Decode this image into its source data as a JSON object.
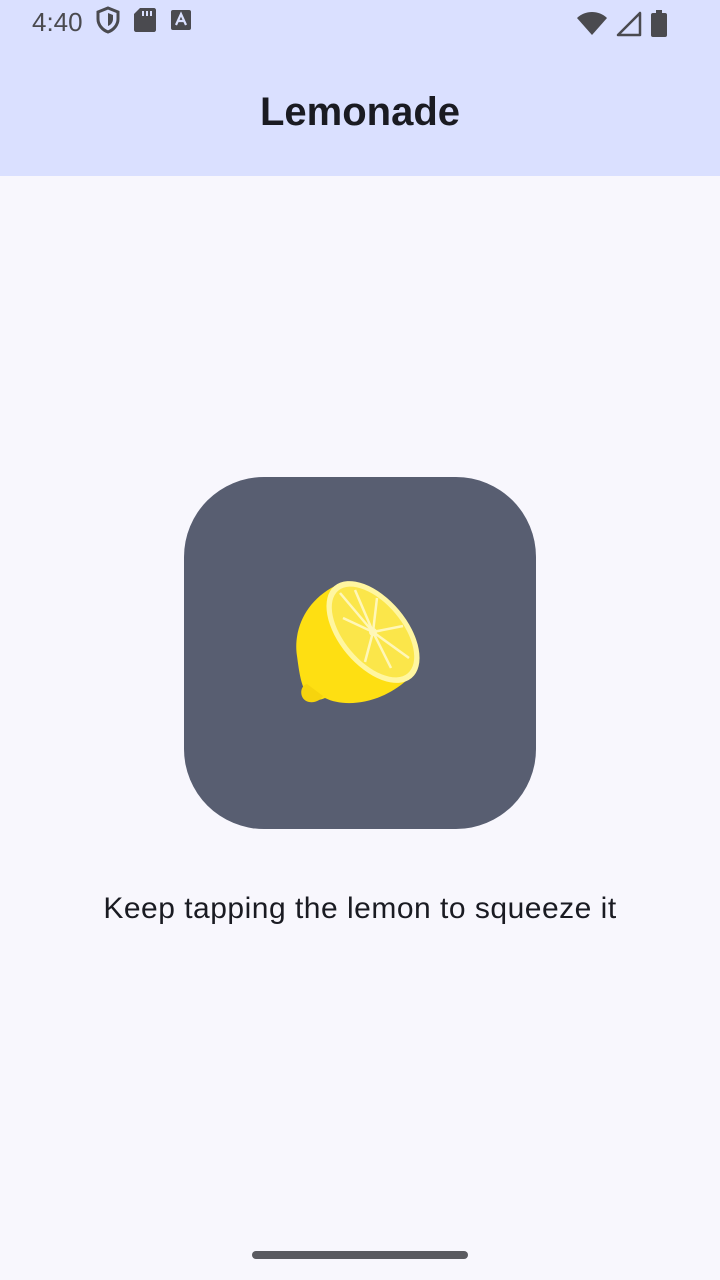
{
  "status_bar": {
    "time": "4:40",
    "icons_left": [
      "shield-icon",
      "sd-card-icon",
      "keyboard-a-icon"
    ],
    "icons_right": [
      "wifi-icon",
      "cell-signal-icon",
      "battery-icon"
    ]
  },
  "app_bar": {
    "title": "Lemonade",
    "background_color": "#dae0ff"
  },
  "main": {
    "image_icon": "lemon-squeeze-icon",
    "image_button_color": "#585e71",
    "instruction": "Keep tapping the lemon to squeeze it"
  },
  "navigation": {
    "gesture_bar": "home-indicator"
  }
}
